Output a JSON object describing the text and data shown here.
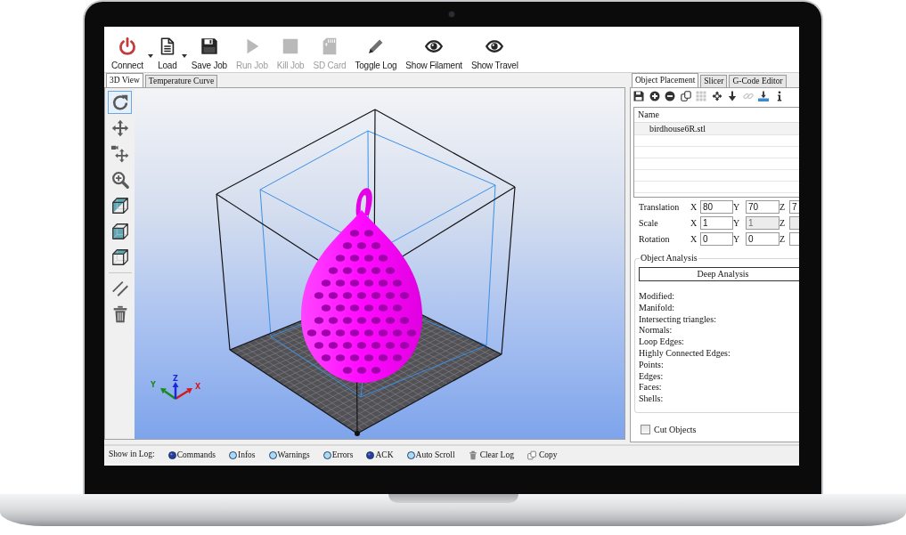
{
  "toolbar": [
    {
      "kind": "power",
      "label": "Connect",
      "disabled": false,
      "dropdown": true
    },
    {
      "kind": "document",
      "label": "Load",
      "disabled": false,
      "dropdown": true
    },
    {
      "kind": "floppy",
      "label": "Save Job",
      "disabled": false,
      "dropdown": false
    },
    {
      "kind": "play",
      "label": "Run Job",
      "disabled": true,
      "dropdown": false
    },
    {
      "kind": "stop",
      "label": "Kill Job",
      "disabled": true,
      "dropdown": false
    },
    {
      "kind": "sdcard",
      "label": "SD Card",
      "disabled": true,
      "dropdown": false
    },
    {
      "kind": "pencil",
      "label": "Toggle Log",
      "disabled": false,
      "dropdown": false
    },
    {
      "kind": "eye",
      "label": "Show Filament",
      "disabled": false,
      "dropdown": false
    },
    {
      "kind": "eye",
      "label": "Show Travel",
      "disabled": false,
      "dropdown": false
    }
  ],
  "view_tabs": [
    {
      "label": "3D View",
      "selected": true
    },
    {
      "label": "Temperature Curve",
      "selected": false
    }
  ],
  "view_tools": [
    [
      {
        "kind": "rotate",
        "selected": true
      },
      {
        "kind": "move",
        "selected": false
      },
      {
        "kind": "move_view",
        "selected": false
      },
      {
        "kind": "zoom",
        "selected": false
      },
      {
        "kind": "cube_iso",
        "selected": false
      },
      {
        "kind": "cube_front",
        "selected": false
      },
      {
        "kind": "cube_top",
        "selected": false
      }
    ],
    [
      {
        "kind": "parallel",
        "selected": false
      },
      {
        "kind": "trash",
        "selected": false
      }
    ]
  ],
  "scene": {
    "axes": [
      {
        "kind": "x",
        "label": "X",
        "color": "#d41a1a"
      },
      {
        "kind": "y",
        "label": "Y",
        "color": "#1a8a1a"
      },
      {
        "kind": "z",
        "label": "Z",
        "color": "#1a2ad4"
      }
    ]
  },
  "side_tabs": [
    {
      "label": "Object Placement",
      "selected": true
    },
    {
      "label": "Slicer",
      "selected": false
    },
    {
      "label": "G-Code Editor",
      "selected": false
    }
  ],
  "placement_tools": [
    {
      "kind": "save",
      "disabled": false
    },
    {
      "kind": "add",
      "disabled": false
    },
    {
      "kind": "remove",
      "disabled": false
    },
    {
      "kind": "copy",
      "disabled": false
    },
    {
      "kind": "grid",
      "disabled": true
    },
    {
      "kind": "center",
      "disabled": false
    },
    {
      "kind": "drop",
      "disabled": false
    },
    {
      "kind": "link",
      "disabled": true
    },
    {
      "kind": "land",
      "disabled": false
    },
    {
      "kind": "info",
      "disabled": false
    }
  ],
  "object_list": {
    "columns": [
      "Name"
    ],
    "rows": [
      {
        "name": "birdhouse6R.stl"
      }
    ]
  },
  "transform": [
    {
      "label": "Translation",
      "fields": [
        {
          "axis": "X",
          "value": "80",
          "disabled": false
        },
        {
          "axis": "Y",
          "value": "70",
          "disabled": false
        },
        {
          "axis": "Z",
          "value": "7",
          "disabled": false
        }
      ]
    },
    {
      "label": "Scale",
      "fields": [
        {
          "axis": "X",
          "value": "1",
          "disabled": false
        },
        {
          "axis": "Y",
          "value": "1",
          "disabled": true
        },
        {
          "axis": "Z",
          "disabled": true
        }
      ]
    },
    {
      "label": "Rotation",
      "fields": [
        {
          "axis": "X",
          "value": "0",
          "disabled": false
        },
        {
          "axis": "Y",
          "value": "0",
          "disabled": false
        },
        {
          "axis": "Z",
          "disabled": false
        }
      ]
    }
  ],
  "analysis": {
    "title": "Object Analysis",
    "button": "Deep Analysis",
    "stats": [
      "Modified:",
      "Manifold:",
      "Intersecting triangles:",
      "Normals:",
      "Loop Edges:",
      "Highly Connected Edges:",
      "Points:",
      "Edges:",
      "Faces:",
      "Shells:"
    ]
  },
  "cut_objects": {
    "label": "Cut Objects",
    "checked": false
  },
  "log_bar": {
    "label": "Show in Log:",
    "filters": [
      {
        "label": "Commands",
        "on": true
      },
      {
        "label": "Infos",
        "on": false
      },
      {
        "label": "Warnings",
        "on": false
      },
      {
        "label": "Errors",
        "on": false
      },
      {
        "label": "ACK",
        "on": true
      },
      {
        "label": "Auto Scroll",
        "on": false
      }
    ],
    "actions": [
      {
        "kind": "trash",
        "label": "Clear Log"
      },
      {
        "kind": "copy",
        "label": "Copy"
      }
    ]
  }
}
